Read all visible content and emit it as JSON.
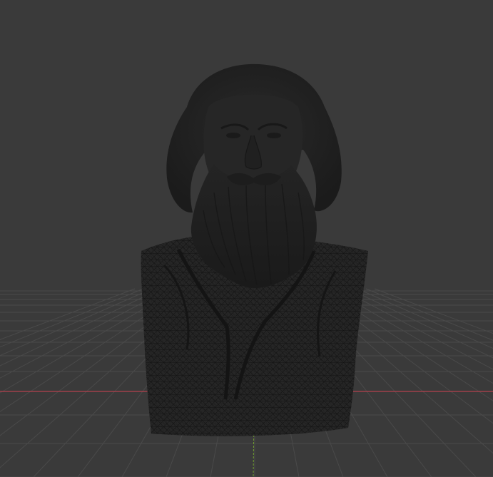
{
  "viewport": {
    "background": "#3a3a3a",
    "grid_color": "#4a4a4a",
    "x_axis_color": "#b4414d",
    "y_axis_color": "#6f9e2f",
    "mesh_fill": "#222222",
    "wire_color": "#111111",
    "view": "perspective",
    "shading": "solid",
    "object": "bust",
    "object_mesh_mode": "partial-wireframe"
  }
}
